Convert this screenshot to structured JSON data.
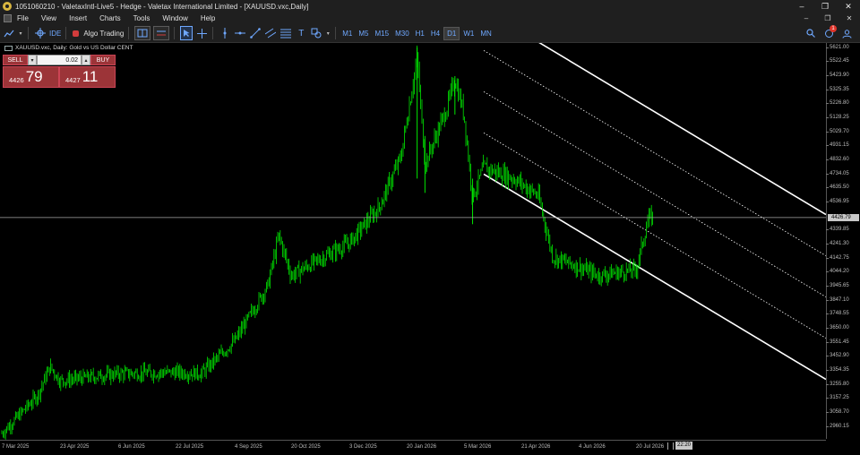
{
  "window": {
    "title": "1051060210 - ValetaxIntl-Live5 - Hedge - Valetax International Limited - [XAUUSD.vxc,Daily]",
    "controls": [
      "–",
      "❐",
      "✕"
    ]
  },
  "menu": {
    "items": [
      "File",
      "View",
      "Insert",
      "Charts",
      "Tools",
      "Window",
      "Help"
    ],
    "mdi_controls": [
      "–",
      "❐",
      "✕"
    ]
  },
  "toolbar": {
    "ide_label": "IDE",
    "algo_label": "Algo Trading",
    "timeframes": [
      "M1",
      "M5",
      "M15",
      "M30",
      "H1",
      "H4",
      "D1",
      "W1",
      "MN"
    ],
    "selected_timeframe": "D1",
    "notification_count": "1"
  },
  "chart": {
    "label": "XAUUSD.vxc, Daily:  Gold vs US Dollar CENT",
    "bid_label": "4426.79",
    "time_label": "22:20"
  },
  "trade": {
    "sell_label": "SELL",
    "buy_label": "BUY",
    "lot": "0.02",
    "sell_price_small": "4426",
    "sell_price_big": "79",
    "buy_price_small": "4427",
    "buy_price_big": "11"
  },
  "colors": {
    "background": "#000000",
    "candles": "#00e600",
    "channel_lines": "#ffffff",
    "trade_panel": "#9c3438",
    "accent": "#6fa8ff"
  },
  "chart_data": {
    "type": "candlestick",
    "symbol": "XAUUSD.vxc",
    "timeframe": "Daily",
    "y_ticks": [
      "5621.00",
      "5522.45",
      "5423.90",
      "5325.35",
      "5226.80",
      "5128.25",
      "5029.70",
      "4931.15",
      "4832.60",
      "4734.05",
      "4635.50",
      "4536.95",
      "4339.85",
      "4241.30",
      "4142.75",
      "4044.20",
      "3945.65",
      "3847.10",
      "3748.55",
      "3650.00",
      "3551.45",
      "3452.90",
      "3354.35",
      "3255.80",
      "3157.25",
      "3058.70",
      "2960.15"
    ],
    "x_ticks": [
      "7 Mar 2025",
      "23 Apr 2025",
      "6 Jun 2025",
      "22 Jul 2025",
      "4 Sep 2025",
      "20 Oct 2025",
      "3 Dec 2025",
      "20 Jan 2026",
      "5 Mar 2026",
      "21 Apr 2026",
      "4 Jun 2026",
      "20 Jul 2026"
    ],
    "ylim": [
      2910,
      5640
    ],
    "approx_close_path": [
      [
        "7 Mar 2025",
        2910
      ],
      [
        "20 Mar 2025",
        3030
      ],
      [
        "5 Apr 2025",
        3180
      ],
      [
        "15 Apr 2025",
        3380
      ],
      [
        "23 Apr 2025",
        3280
      ],
      [
        "6 Jun 2025",
        3330
      ],
      [
        "22 Jul 2025",
        3340
      ],
      [
        "10 Aug 2025",
        3330
      ],
      [
        "4 Sep 2025",
        3560
      ],
      [
        "1 Oct 2025",
        3950
      ],
      [
        "10 Oct 2025",
        4300
      ],
      [
        "20 Oct 2025",
        4020
      ],
      [
        "3 Dec 2025",
        4250
      ],
      [
        "28 Dec 2025",
        4500
      ],
      [
        "15 Jan 2026",
        4850
      ],
      [
        "28 Jan 2026",
        5550
      ],
      [
        "3 Feb 2026",
        4800
      ],
      [
        "20 Feb 2026",
        5200
      ],
      [
        "26 Feb 2026",
        5400
      ],
      [
        "5 Mar 2026",
        5150
      ],
      [
        "12 Mar 2026",
        4570
      ],
      [
        "21 Mar 2026",
        4780
      ],
      [
        "15 Apr 2026",
        4700
      ],
      [
        "4 May 2026",
        4580
      ],
      [
        "15 May 2026",
        4150
      ],
      [
        "4 Jun 2026",
        4080
      ],
      [
        "20 Jun 2026",
        4020
      ],
      [
        "20 Jul 2026",
        4060
      ],
      [
        "30 Jul 2026",
        4420
      ],
      [
        "3 Aug 2026",
        4430
      ]
    ],
    "channel": {
      "type": "regression channel (5 parallel lines, 2 solid outer + 3 dotted inner)",
      "slope": "descending"
    },
    "grid": false
  }
}
